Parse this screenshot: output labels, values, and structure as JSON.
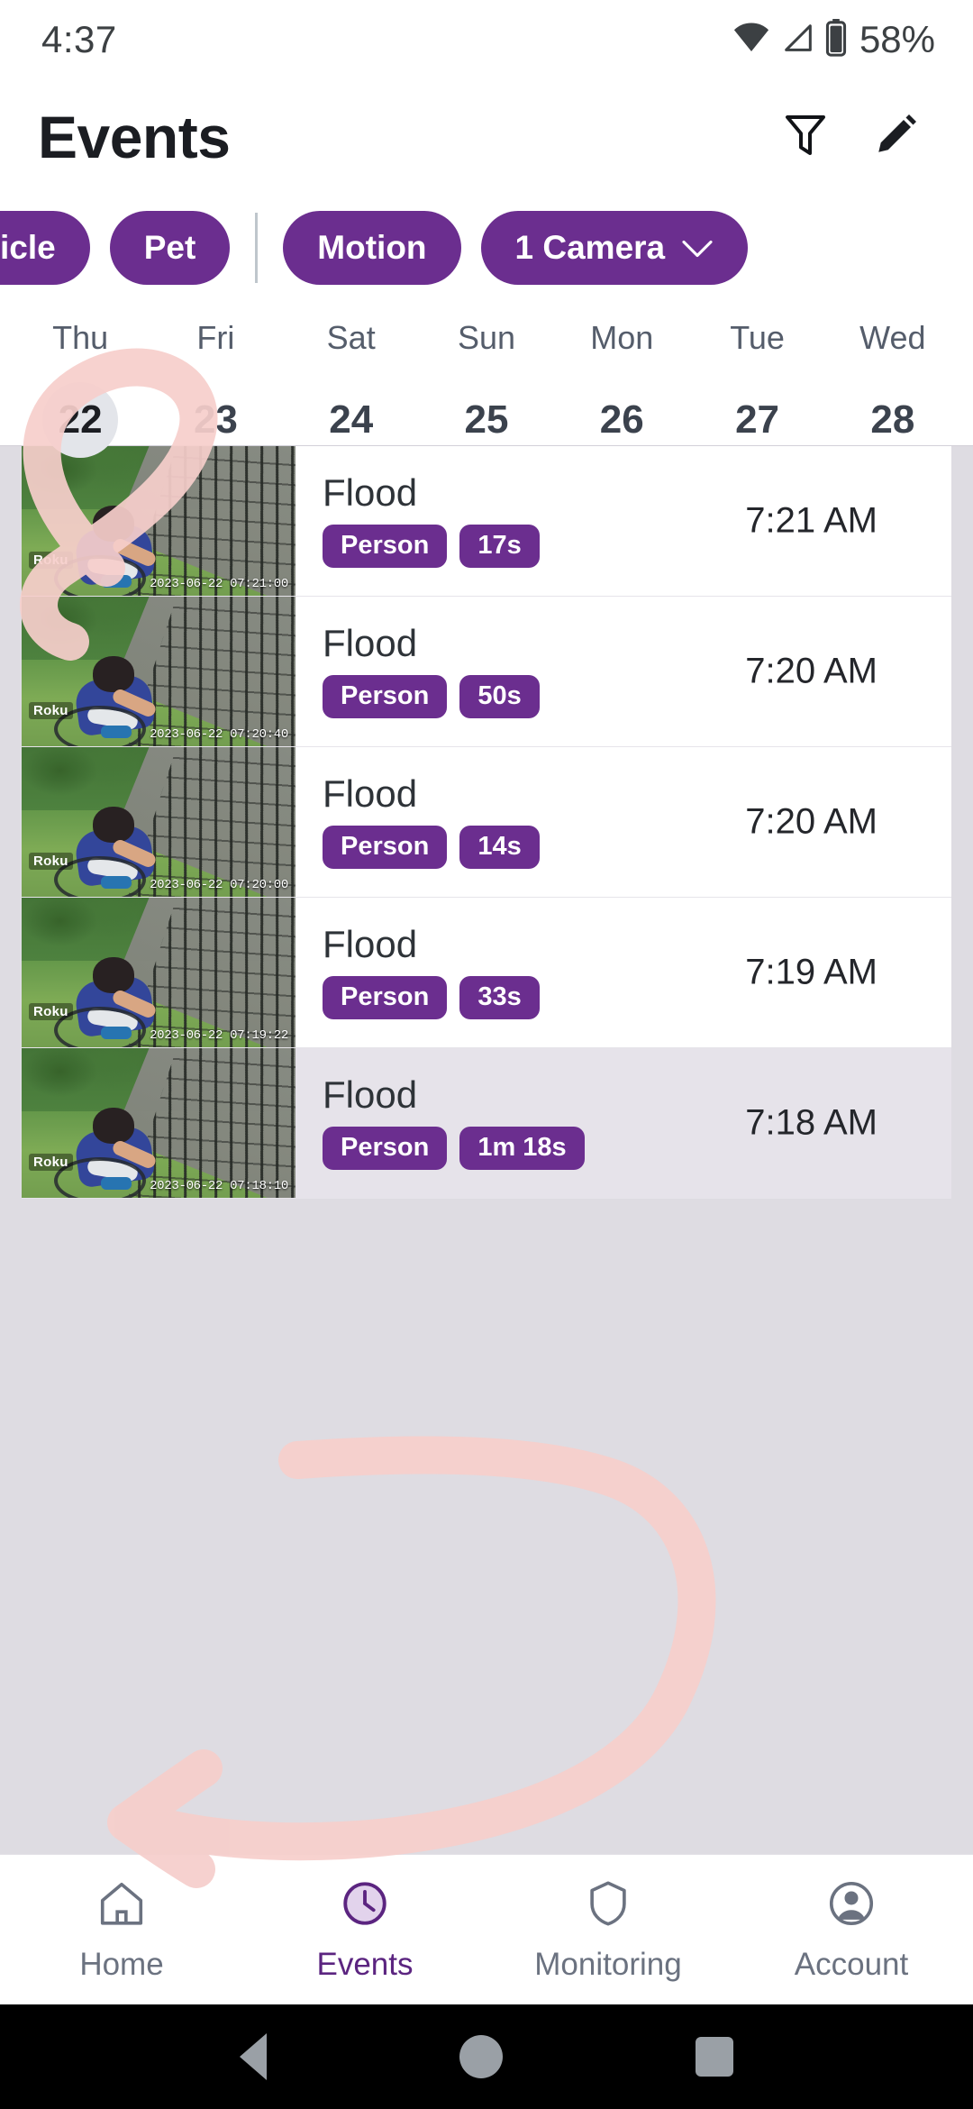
{
  "status_bar": {
    "time": "4:37",
    "battery_percent": "58%",
    "icons": [
      "wifi-icon",
      "cellular-signal-icon",
      "battery-icon"
    ]
  },
  "header": {
    "title": "Events",
    "filter_icon": "filter-funnel-icon",
    "edit_icon": "pencil-edit-icon"
  },
  "filter_chips": [
    {
      "label": "icle",
      "full_label": "Vehicle",
      "truncated": true,
      "selected": true
    },
    {
      "label": "Pet",
      "selected": true
    },
    {
      "label": "Motion",
      "selected": true
    },
    {
      "label": "1 Camera",
      "selected": true,
      "has_dropdown": true,
      "caret": "⌄"
    }
  ],
  "date_strip": {
    "days": [
      {
        "name": "Thu",
        "num": "22",
        "selected": true
      },
      {
        "name": "Fri",
        "num": "23",
        "selected": false
      },
      {
        "name": "Sat",
        "num": "24",
        "selected": false
      },
      {
        "name": "Sun",
        "num": "25",
        "selected": false
      },
      {
        "name": "Mon",
        "num": "26",
        "selected": false
      },
      {
        "name": "Tue",
        "num": "27",
        "selected": false
      },
      {
        "name": "Wed",
        "num": "28",
        "selected": false
      }
    ]
  },
  "events": [
    {
      "title": "Flood",
      "object_badge": "Person",
      "duration_badge": "17s",
      "time": "7:21 AM",
      "thumbnail_brand": "Roku",
      "thumbnail_stamp": "2023-06-22 07:21:00",
      "highlighted": false
    },
    {
      "title": "Flood",
      "object_badge": "Person",
      "duration_badge": "50s",
      "time": "7:20 AM",
      "thumbnail_brand": "Roku",
      "thumbnail_stamp": "2023-06-22 07:20:40",
      "highlighted": false
    },
    {
      "title": "Flood",
      "object_badge": "Person",
      "duration_badge": "14s",
      "time": "7:20 AM",
      "thumbnail_brand": "Roku",
      "thumbnail_stamp": "2023-06-22 07:20:00",
      "highlighted": false
    },
    {
      "title": "Flood",
      "object_badge": "Person",
      "duration_badge": "33s",
      "time": "7:19 AM",
      "thumbnail_brand": "Roku",
      "thumbnail_stamp": "2023-06-22 07:19:22",
      "highlighted": false
    },
    {
      "title": "Flood",
      "object_badge": "Person",
      "duration_badge": "1m 18s",
      "time": "7:18 AM",
      "thumbnail_brand": "Roku",
      "thumbnail_stamp": "2023-06-22 07:18:10",
      "highlighted": true
    }
  ],
  "bottom_nav": [
    {
      "label": "Home",
      "icon": "house-icon",
      "active": false
    },
    {
      "label": "Events",
      "icon": "clock-icon",
      "active": true
    },
    {
      "label": "Monitoring",
      "icon": "shield-icon",
      "active": false
    },
    {
      "label": "Account",
      "icon": "person-circle-icon",
      "active": false
    }
  ],
  "system_nav": {
    "back": "back-triangle-icon",
    "home": "home-circle-icon",
    "recents": "recents-square-icon"
  },
  "colors": {
    "accent_purple": "#6b2e8f",
    "active_nav_purple": "#5b2480",
    "list_background": "#dedce2",
    "row_highlight": "#e6e3ea",
    "annotation_pink": "#f7cfcd"
  },
  "annotation": {
    "type": "hand-drawn-highlight",
    "shapes": [
      "loop-circle-over-thu-22",
      "large-arrow-around-bottom-events"
    ]
  }
}
